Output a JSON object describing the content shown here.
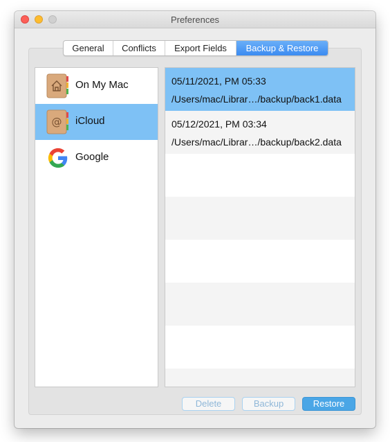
{
  "window": {
    "title": "Preferences"
  },
  "tabs": [
    {
      "label": "General",
      "active": false
    },
    {
      "label": "Conflicts",
      "active": false
    },
    {
      "label": "Export Fields",
      "active": false
    },
    {
      "label": "Backup & Restore",
      "active": true
    }
  ],
  "sidebar": {
    "items": [
      {
        "label": "On My Mac",
        "icon": "home-book-icon",
        "selected": false
      },
      {
        "label": "iCloud",
        "icon": "at-book-icon",
        "selected": true
      },
      {
        "label": "Google",
        "icon": "google-icon",
        "selected": false
      }
    ]
  },
  "backups": [
    {
      "date": "05/11/2021, PM 05:33",
      "path": "/Users/mac/Librar…/backup/back1.data",
      "selected": true
    },
    {
      "date": "05/12/2021, PM 03:34",
      "path": "/Users/mac/Librar…/backup/back2.data",
      "selected": false
    }
  ],
  "buttons": {
    "delete": "Delete",
    "backup": "Backup",
    "restore": "Restore"
  },
  "colors": {
    "selection": "#7ec1f5",
    "tab_active": "#3b8bf1",
    "primary_button": "#4aa6e6"
  }
}
